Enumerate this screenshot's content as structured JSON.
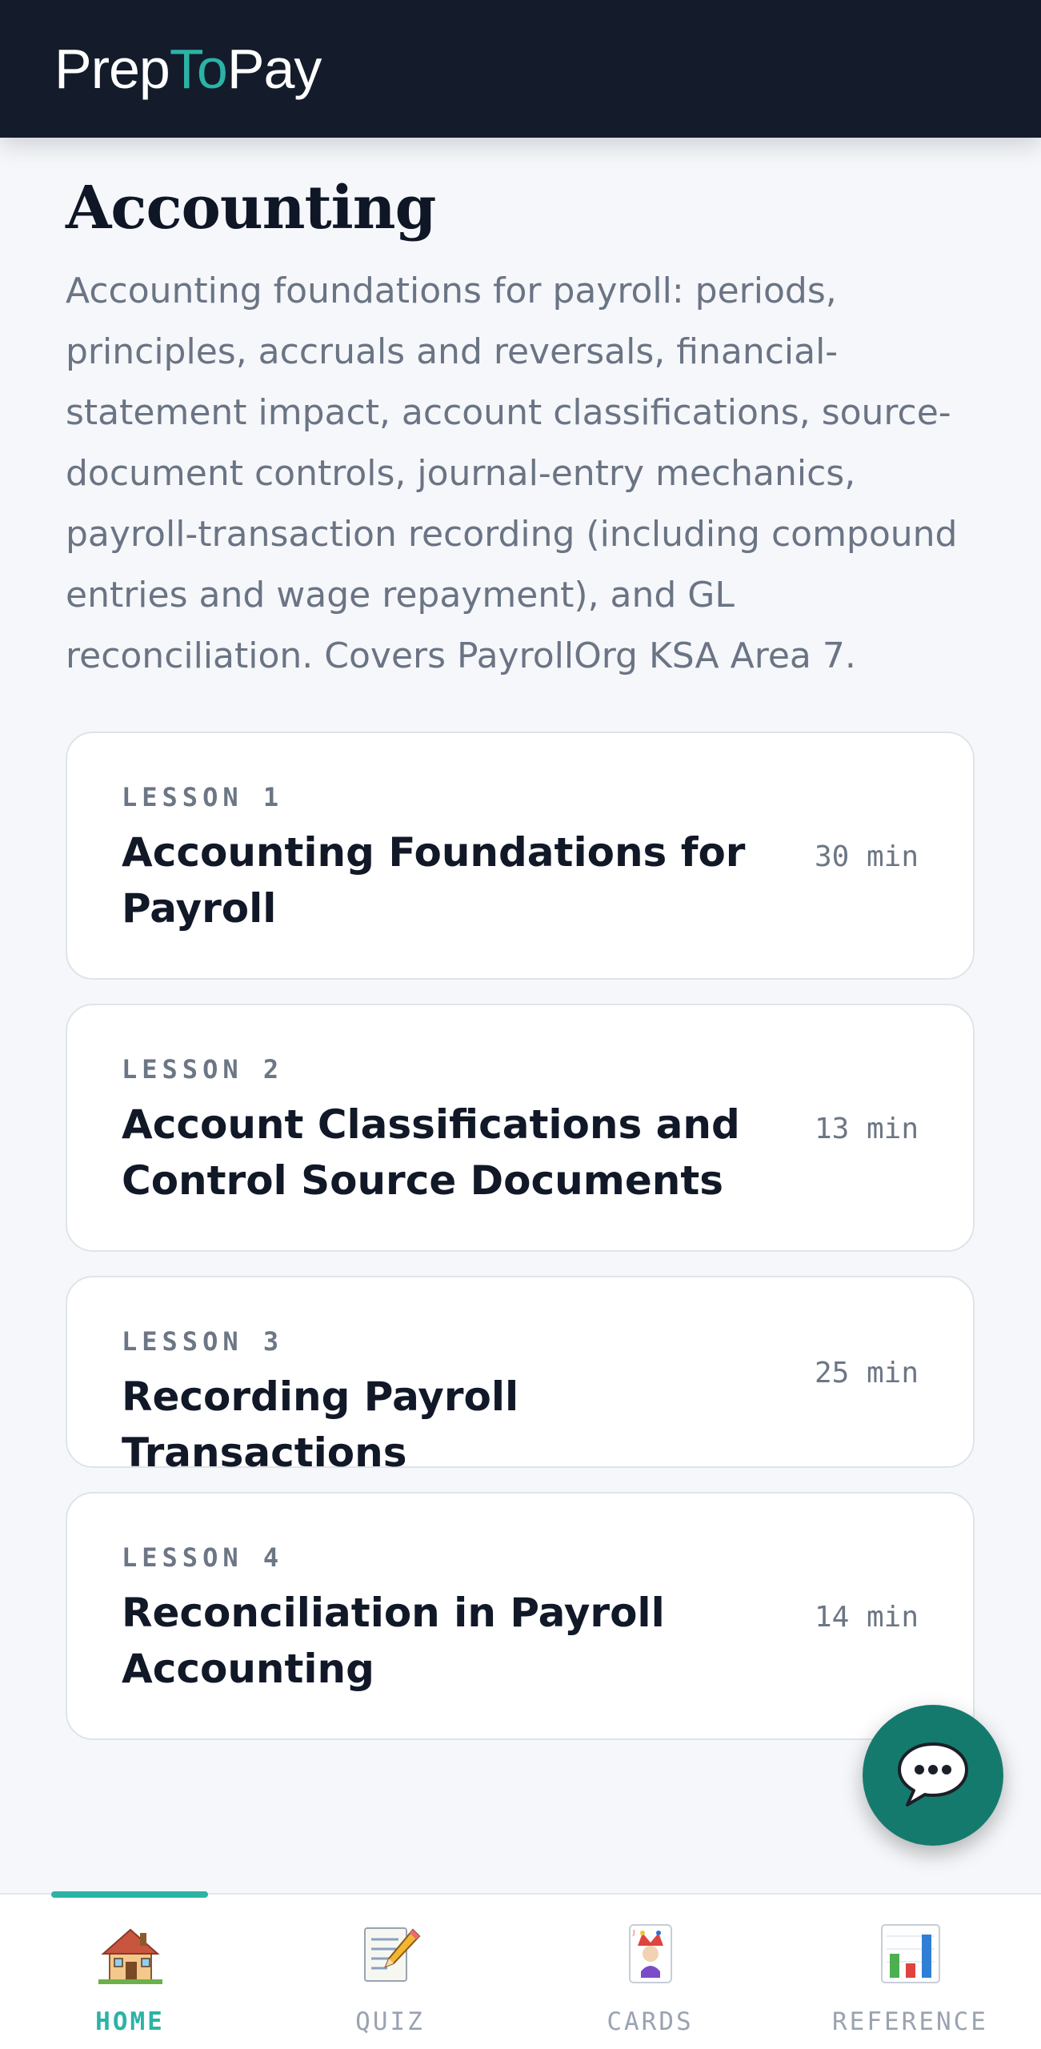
{
  "header": {
    "logo_part1": "Prep",
    "logo_part2": "To",
    "logo_part3": "Pay"
  },
  "page": {
    "title": "Accounting",
    "description": "Accounting foundations for payroll: periods, principles, accruals and reversals, financial-statement impact, account classifications, source-document controls, journal-entry mechanics, payroll-transaction recording (including compound entries and wage repayment), and GL reconciliation. Covers PayrollOrg KSA Area 7."
  },
  "lessons": [
    {
      "number": "LESSON 1",
      "title": "Accounting Foundations for Payroll",
      "duration": "30 min"
    },
    {
      "number": "LESSON 2",
      "title": "Account Classifications and Control Source Documents",
      "duration": "13 min"
    },
    {
      "number": "LESSON 3",
      "title": "Recording Payroll Transactions",
      "duration": "25 min"
    },
    {
      "number": "LESSON 4",
      "title": "Reconciliation in Payroll Accounting",
      "duration": "14 min"
    }
  ],
  "chat_button": {
    "icon": "speech-bubble-icon"
  },
  "bottom_nav": {
    "active": "HOME",
    "items": [
      {
        "label": "HOME",
        "icon": "house-icon"
      },
      {
        "label": "QUIZ",
        "icon": "memo-pencil-icon"
      },
      {
        "label": "CARDS",
        "icon": "joker-card-icon"
      },
      {
        "label": "REFERENCE",
        "icon": "bar-chart-icon"
      }
    ]
  },
  "colors": {
    "header_bg": "#141c2b",
    "brand_accent": "#2bb3a5",
    "chat_fab": "#157a6e",
    "page_bg": "#f5f7fa"
  }
}
